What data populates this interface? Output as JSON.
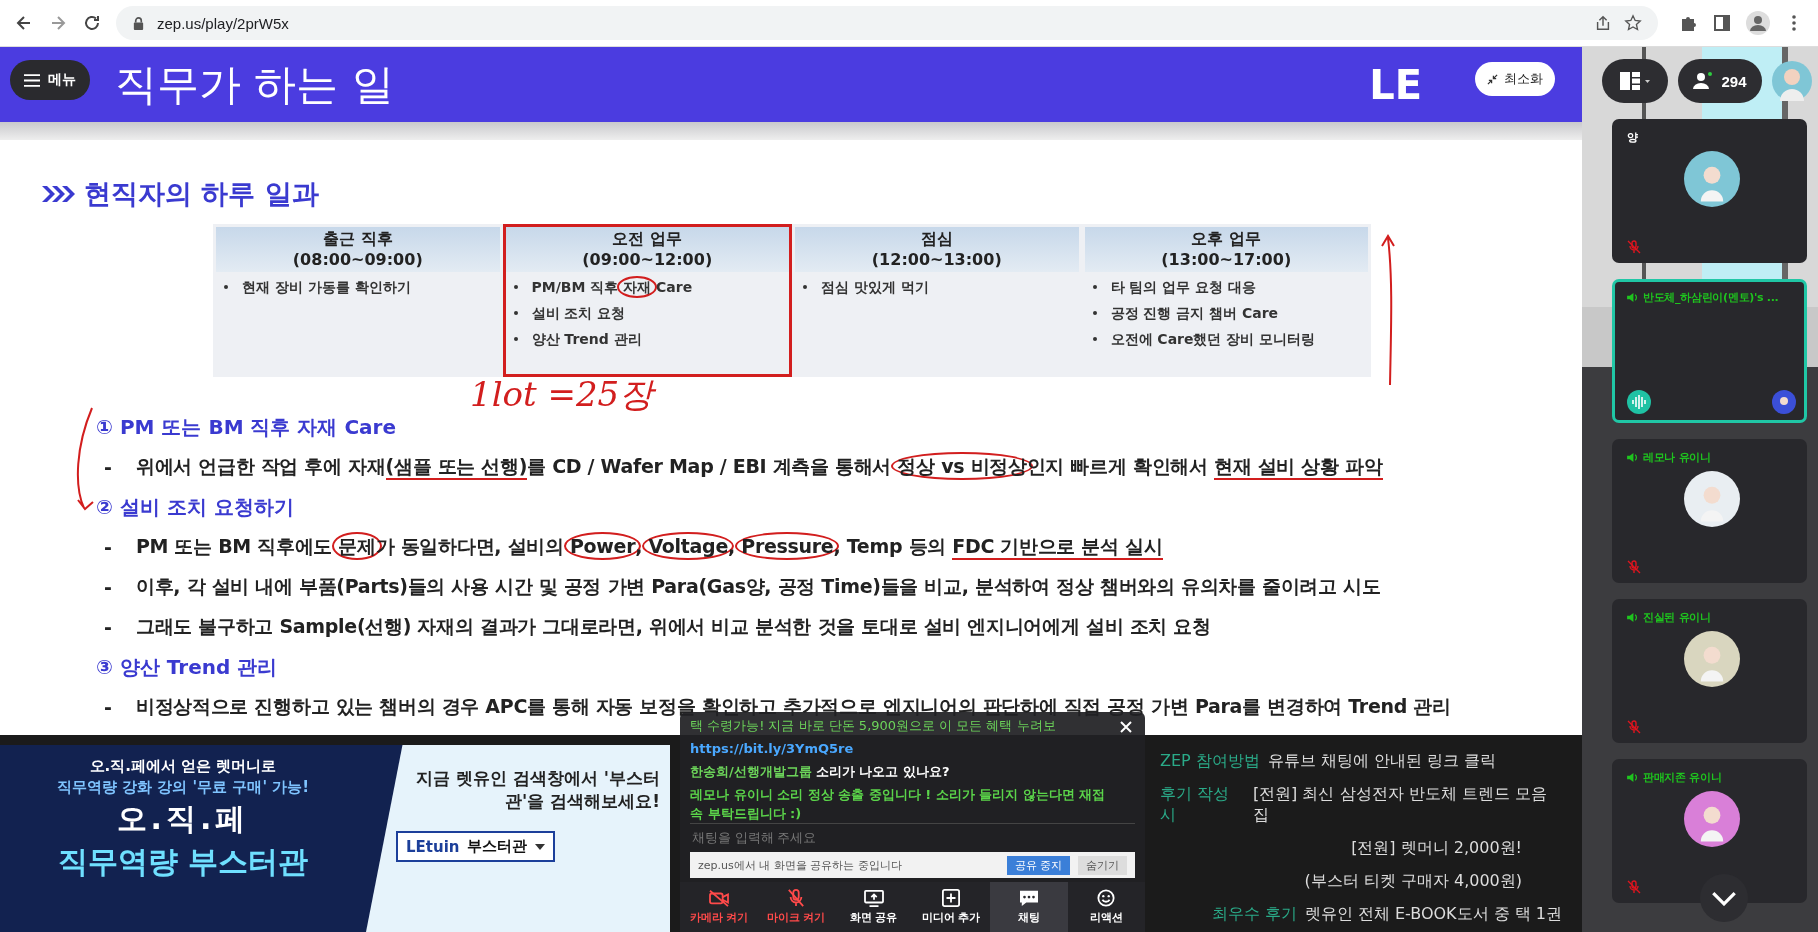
{
  "browser": {
    "url": "zep.us/play/2prW5x"
  },
  "menu_button": "메뉴",
  "minimize_button": "최소화",
  "slide": {
    "title": "직무가 하는 일",
    "logo": "LE",
    "section": "현직자의 하루 일과",
    "handwriting": "1lot =25장",
    "schedule": [
      {
        "heading": "출근 직후",
        "time": "(08:00~09:00)",
        "tasks": [
          [
            {
              "text": "현재 장비 가동를 확인하기",
              "circled": false,
              "underlined": false
            }
          ]
        ],
        "highlighted": false
      },
      {
        "heading": "오전 업무",
        "time": "(09:00~12:00)",
        "tasks": [
          [
            {
              "text": "PM/BM 직후 ",
              "circled": false,
              "underlined": false
            },
            {
              "text": "자재",
              "circled": true,
              "underlined": false
            },
            {
              "text": " Care",
              "circled": false,
              "underlined": false
            }
          ],
          [
            {
              "text": "설비 조치 요청",
              "circled": false,
              "underlined": false
            }
          ],
          [
            {
              "text": "양산 Trend 관리",
              "circled": false,
              "underlined": false
            }
          ]
        ],
        "highlighted": true
      },
      {
        "heading": "점심",
        "time": "(12:00~13:00)",
        "tasks": [
          [
            {
              "text": "점심 맛있게 먹기",
              "circled": false,
              "underlined": false
            }
          ]
        ],
        "highlighted": false
      },
      {
        "heading": "오후 업무",
        "time": "(13:00~17:00)",
        "tasks": [
          [
            {
              "text": "타 팀의 업무 요청 대응",
              "circled": false,
              "underlined": false
            }
          ],
          [
            {
              "text": "공정 진행 금지 챔버 Care",
              "circled": false,
              "underlined": false
            }
          ],
          [
            {
              "text": "오전에 Care했던 장비 모니터링",
              "circled": false,
              "underlined": false
            }
          ]
        ],
        "highlighted": false
      }
    ],
    "bullet": "-",
    "topics": [
      {
        "number": "①",
        "title": "PM 또는 BM 직후 자재 Care",
        "points": [
          [
            {
              "text": "위에서 언급한 작업 후에 자재",
              "circled": false,
              "underlined": false
            },
            {
              "text": "(샘플 또는 선행)",
              "circled": false,
              "underlined": true
            },
            {
              "text": "를 CD / Wafer Map / EBI 계측을 통해서 ",
              "circled": false,
              "underlined": false
            },
            {
              "text": "정상 vs 비정상",
              "circled": true,
              "underlined": false
            },
            {
              "text": "인지 빠르게 확인해서 ",
              "circled": false,
              "underlined": false
            },
            {
              "text": "현재 설비 상황 파악",
              "circled": false,
              "underlined": true
            }
          ]
        ]
      },
      {
        "number": "②",
        "title": "설비 조치 요청하기",
        "points": [
          [
            {
              "text": "PM 또는 BM 직후에도 ",
              "circled": false,
              "underlined": false
            },
            {
              "text": "문제",
              "circled": true,
              "underlined": false
            },
            {
              "text": "가 동일하다면, 설비의 ",
              "circled": false,
              "underlined": false
            },
            {
              "text": "Power",
              "circled": true,
              "underlined": false
            },
            {
              "text": ", ",
              "circled": false,
              "underlined": false
            },
            {
              "text": "Voltage",
              "circled": true,
              "underlined": false
            },
            {
              "text": ", ",
              "circled": false,
              "underlined": false
            },
            {
              "text": "Pressure",
              "circled": true,
              "underlined": false
            },
            {
              "text": ", Temp 등의 ",
              "circled": false,
              "underlined": false
            },
            {
              "text": "FDC 기반으로 분석 실시",
              "circled": false,
              "underlined": true
            }
          ],
          [
            {
              "text": "이후, 각 설비 내에 부품(Parts)들의 사용 시간 및 공정 가변 Para(Gas양, 공정 Time)들을 비교, 분석하여 정상 챔버와의 유의차를 줄이려고 시도",
              "circled": false,
              "underlined": false
            }
          ],
          [
            {
              "text": "그래도 불구하고 Sample(선행) 자재의 결과가 그대로라면, 위에서 비교 분석한 것을 토대로 설비 엔지니어에게 설비 조치 요청",
              "circled": false,
              "underlined": false
            }
          ]
        ]
      },
      {
        "number": "③",
        "title": "양산 Trend 관리",
        "points": [
          [
            {
              "text": "비정상적으로 진행하고 있는 챔버의 경우 APC를 통해 자동 보정을 확인하고 추가적으로 엔지니어의 판단하에 직접 공정 가변 Para를 변경하여 Trend 관리",
              "circled": false,
              "underlined": false
            }
          ]
        ]
      }
    ]
  },
  "banner": {
    "intro": "오.직.페에서 얻은 렛머니로",
    "offer": "직무역량 강화 강의 '무료 구매' 가능!",
    "brand": "오.직.페",
    "headline": "직무역량 부스터관",
    "guide": "지금 렛유인 검색창에서 '부스터관'을 검색해보세요!",
    "search_logo": "LEtuin",
    "search_text": "부스터관"
  },
  "notice_board": [
    {
      "label": "ZEP 참여방법",
      "text": "유튜브 채팅에 안내된 링크 클릭"
    },
    {
      "label": "후기 작성시",
      "text": "[전원] 최신 삼성전자 반도체 트렌드 모음집"
    },
    {
      "text": "[전원] 렛머니 2,000원!"
    },
    {
      "text": "(부스터 티켓 구매자 4,000원)"
    },
    {
      "label": "최우수 후기",
      "text": "렛유인 전체 E-BOOK도서 중 택 1권"
    }
  ],
  "chat": {
    "messages": [
      {
        "kind": "notice",
        "text": "택 수령가능! 지금 바로 단돈 5,900원으로 이 모든 혜택 누려보"
      },
      {
        "kind": "link",
        "text": "https://bit.ly/3YmQ5re"
      },
      {
        "kind": "message",
        "author": "한송희/선행개발그룹",
        "text": "소리가 나오고 있나요?"
      },
      {
        "kind": "system",
        "text": "레모나 유이니 소리 정상 송출 중입니다 ! 소리가 들리지 않는다면 재접속 부탁드립니다 :)"
      }
    ],
    "placeholder": "채팅을 입력해 주세요"
  },
  "share_notice": {
    "text": "zep.us에서 내 화면을 공유하는 중입니다",
    "buttons": [
      "공유 중지",
      "숨기기"
    ]
  },
  "toolbar": [
    {
      "label": "카메라 켜기",
      "off": true,
      "selected": false
    },
    {
      "label": "마이크 켜기",
      "off": true,
      "selected": false
    },
    {
      "label": "화면 공유",
      "off": false,
      "selected": false
    },
    {
      "label": "미디어 추가",
      "off": false,
      "selected": false
    },
    {
      "label": "채팅",
      "off": false,
      "selected": true
    },
    {
      "label": "리액션",
      "off": false,
      "selected": false
    }
  ],
  "participants": "294",
  "tiles": [
    {
      "name": "양",
      "sound_on": false,
      "active": false,
      "muted": true,
      "kind": "avatar",
      "color": "#7fc6d6"
    },
    {
      "name": "반도체_하삼린이(멘토)'s ...",
      "sound_on": true,
      "active": true,
      "muted": false,
      "kind": "screen",
      "color": "#3b4fd8"
    },
    {
      "name": "레모나 유이니",
      "sound_on": true,
      "active": false,
      "muted": true,
      "kind": "avatar",
      "color": "#e9eef2"
    },
    {
      "name": "진실된 유이니",
      "sound_on": true,
      "active": false,
      "muted": true,
      "kind": "avatar",
      "color": "#d9d6bf"
    },
    {
      "name": "판매지존 유이니",
      "sound_on": true,
      "active": false,
      "muted": true,
      "kind": "avatar",
      "color": "#d97fd8"
    }
  ]
}
